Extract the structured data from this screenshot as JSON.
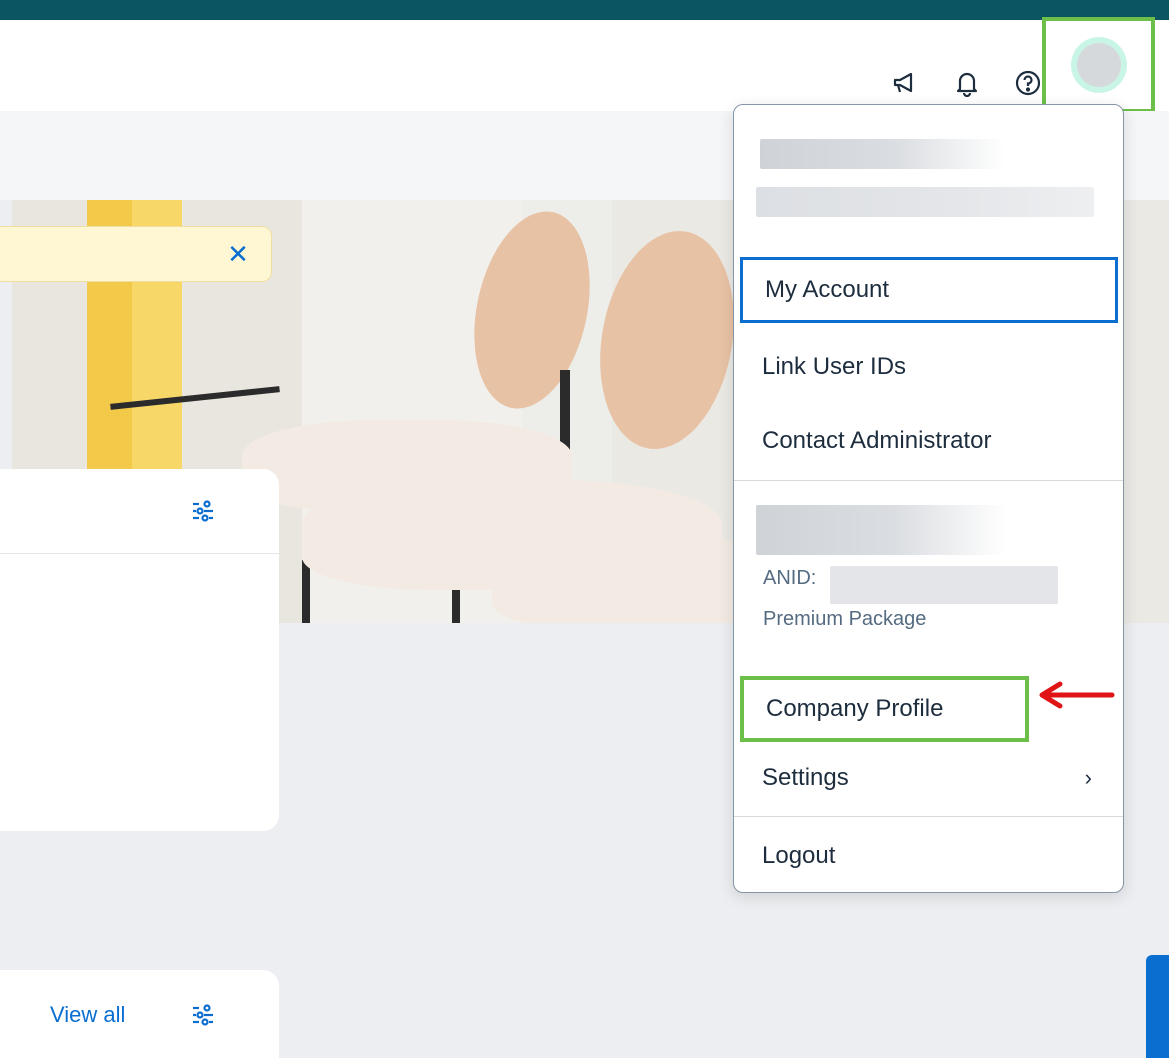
{
  "header": {
    "icons": {
      "announcement": "megaphone-icon",
      "notifications": "bell-icon",
      "help": "help-circle-icon",
      "avatar": "user-avatar"
    }
  },
  "banner": {
    "close_glyph": "✕"
  },
  "cards": {
    "widget2": {
      "view_all_label": "View all"
    }
  },
  "user_menu": {
    "items": {
      "my_account": "My Account",
      "link_user_ids": "Link User IDs",
      "contact_admin": "Contact Administrator",
      "company_profile": "Company Profile",
      "settings": "Settings",
      "logout": "Logout"
    },
    "settings_chevron": "›",
    "account_info": {
      "anid_label": "ANID:",
      "package": "Premium Package"
    }
  },
  "colors": {
    "brand_strip": "#0b5563",
    "accent_blue": "#0a6ed1",
    "annotation_green": "#6cc04a",
    "annotation_red": "#e01414",
    "banner_yellow": "#fff6d3"
  }
}
